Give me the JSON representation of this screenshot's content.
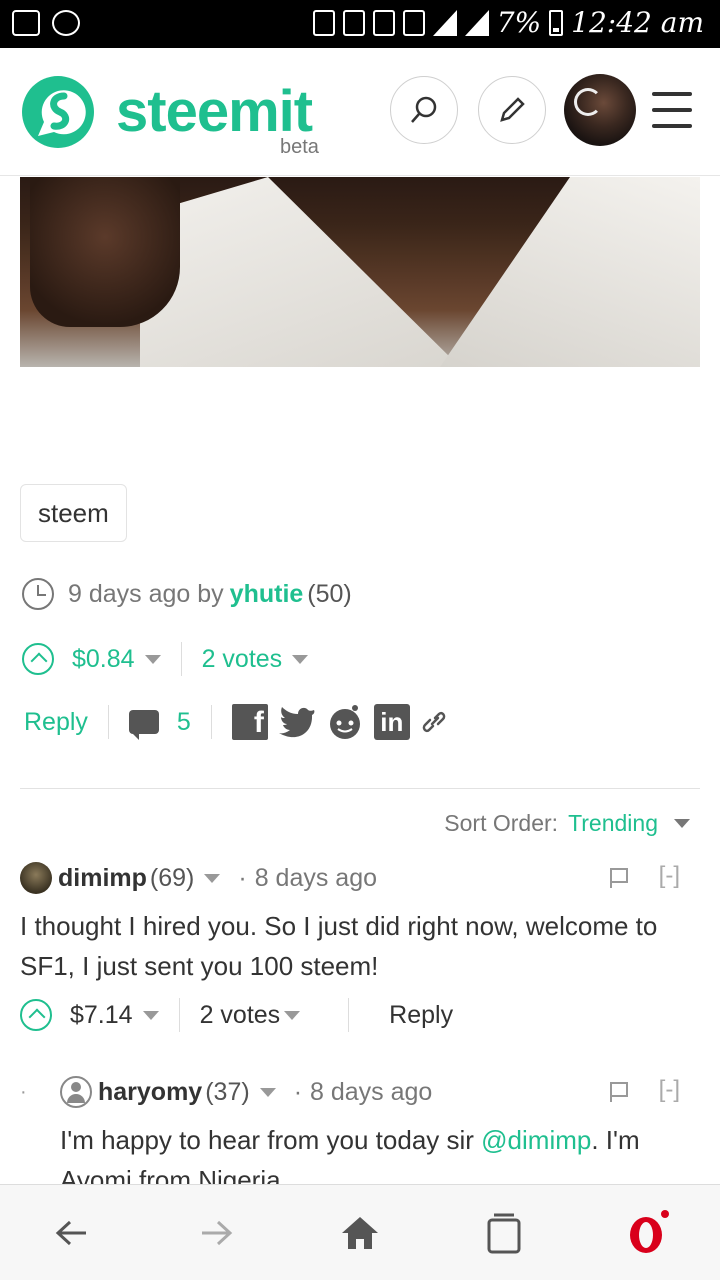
{
  "status_bar": {
    "battery": "7%",
    "time": "12:42 am"
  },
  "header": {
    "logo_text": "steemit",
    "beta": "beta"
  },
  "post": {
    "tag": "steem",
    "age": "9 days ago by",
    "author": "yhutie",
    "reputation": "(50)",
    "payout": "$0.84",
    "votes": "2 votes",
    "reply_label": "Reply",
    "comment_count": "5"
  },
  "sort": {
    "label": "Sort Order:",
    "value": "Trending"
  },
  "comments": [
    {
      "author": "dimimp",
      "reputation": "(69)",
      "age": "8 days ago",
      "collapse": "[-]",
      "body": "I thought I hired you. So I just did right now, welcome to SF1, I just sent you 100 steem!",
      "payout": "$7.14",
      "votes": "2 votes",
      "reply_label": "Reply"
    },
    {
      "author": "haryomy",
      "reputation": "(37)",
      "age": "8 days ago",
      "collapse": "[-]",
      "body_prefix": "I'm happy to hear from you today sir ",
      "mention": "@dimimp",
      "body_suffix": ". I'm Ayomi from Nigeria"
    }
  ],
  "colors": {
    "accent": "#1fbf8f",
    "opera": "#d9001b"
  },
  "icons": [
    "search-icon",
    "pencil-icon",
    "menu-icon",
    "clock-icon",
    "upvote-icon",
    "comment-icon",
    "facebook-icon",
    "twitter-icon",
    "reddit-icon",
    "linkedin-icon",
    "link-icon",
    "flag-icon",
    "back-icon",
    "forward-icon",
    "home-icon",
    "tabs-icon",
    "opera-icon"
  ]
}
